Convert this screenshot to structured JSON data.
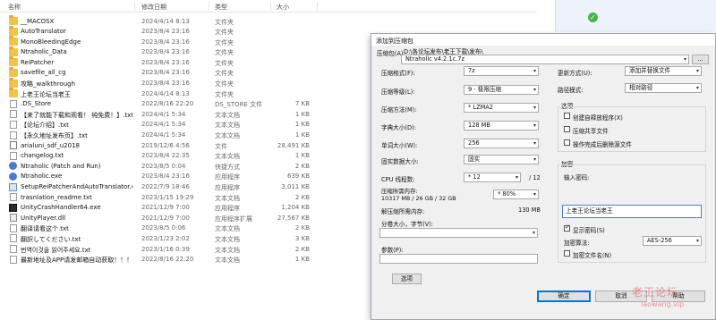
{
  "explorer": {
    "columns": {
      "name": "名称",
      "date": "修改日期",
      "type": "类型",
      "size": "大小"
    },
    "files": [
      {
        "icon": "folder-icon",
        "name": "__MACOSX",
        "date": "2024/4/14 8:13",
        "type": "文件夹",
        "size": ""
      },
      {
        "icon": "folder-icon",
        "name": "AutoTranslator",
        "date": "2023/8/4 23:16",
        "type": "文件夹",
        "size": ""
      },
      {
        "icon": "folder-icon",
        "name": "MonoBleedingEdge",
        "date": "2023/8/4 23:16",
        "type": "文件夹",
        "size": ""
      },
      {
        "icon": "folder-icon",
        "name": "Ntraholic_Data",
        "date": "2023/8/4 23:16",
        "type": "文件夹",
        "size": ""
      },
      {
        "icon": "folder-icon",
        "name": "ReiPatcher",
        "date": "2023/8/4 23:16",
        "type": "文件夹",
        "size": ""
      },
      {
        "icon": "folder-icon",
        "name": "savefile_all_cg",
        "date": "2023/8/4 23:16",
        "type": "文件夹",
        "size": ""
      },
      {
        "icon": "folder-icon",
        "name": "攻略_walkthrough",
        "date": "2023/8/4 23:16",
        "type": "文件夹",
        "size": ""
      },
      {
        "icon": "folder-icon",
        "name": "上老王论坛当老王",
        "date": "2024/4/14 8:13",
        "type": "文件夹",
        "size": ""
      },
      {
        "icon": "file-icon",
        "name": ".DS_Store",
        "date": "2022/8/16 22:20",
        "type": "DS_STORE 文件",
        "size": "7 KB"
      },
      {
        "icon": "text-file-icon",
        "name": "【来了就能下载和观看！ 纯免费！】.txt",
        "date": "2024/4/1 5:34",
        "type": "文本文档",
        "size": "1 KB"
      },
      {
        "icon": "text-file-icon",
        "name": "【论坛介绍】.txt",
        "date": "2024/4/1 5:34",
        "type": "文本文档",
        "size": "1 KB"
      },
      {
        "icon": "text-file-icon",
        "name": "【永久地址发布页】.txt",
        "date": "2024/4/1 5:34",
        "type": "文本文档",
        "size": "1 KB"
      },
      {
        "icon": "font-file-icon",
        "name": "arialuni_sdf_u2018",
        "date": "2019/12/6 4:56",
        "type": "文件",
        "size": "28,491 KB"
      },
      {
        "icon": "text-file-icon",
        "name": "changelog.txt",
        "date": "2023/8/4 22:35",
        "type": "文本文档",
        "size": "1 KB"
      },
      {
        "icon": "shortcut-icon",
        "name": "Ntraholic (Patch and Run)",
        "date": "2023/8/5 0:04",
        "type": "快捷方式",
        "size": "2 KB"
      },
      {
        "icon": "app-icon",
        "name": "Ntraholic.exe",
        "date": "2023/8/4 23:16",
        "type": "应用程序",
        "size": "639 KB"
      },
      {
        "icon": "exe-icon",
        "name": "SetupReiPatcherAndAutoTranslator.exe",
        "date": "2022/7/9 18:46",
        "type": "应用程序",
        "size": "3,011 KB"
      },
      {
        "icon": "text-file-icon",
        "name": "trasnlation_readme.txt",
        "date": "2023/1/15 19:29",
        "type": "文本文档",
        "size": "2 KB"
      },
      {
        "icon": "unity-icon",
        "name": "UnityCrashHandler64.exe",
        "date": "2021/12/9 7:00",
        "type": "应用程序",
        "size": "1,204 KB"
      },
      {
        "icon": "dll-icon",
        "name": "UnityPlayer.dll",
        "date": "2021/12/9 7:00",
        "type": "应用程序扩展",
        "size": "27,567 KB"
      },
      {
        "icon": "text-file-icon",
        "name": "翻译请看这个.txt",
        "date": "2023/8/5 0:06",
        "type": "文本文档",
        "size": "2 KB"
      },
      {
        "icon": "text-file-icon",
        "name": "翻訳してください.txt",
        "date": "2023/1/23 2:02",
        "type": "文本文档",
        "size": "3 KB"
      },
      {
        "icon": "text-file-icon",
        "name": "번역이것을 읽어주세요.txt",
        "date": "2023/1/16 0:39",
        "type": "文本文档",
        "size": "2 KB"
      },
      {
        "icon": "text-file-icon",
        "name": "最新地址及APP请发邮箱自动获取！！！...",
        "date": "2022/8/16 22:20",
        "type": "文本文档",
        "size": "1 KB"
      }
    ]
  },
  "dialog": {
    "title": "添加到压缩包",
    "archive_label": "压缩包(A):",
    "archive_path": "D:\\各论坛发布\\老王下载\\发布\\",
    "archive_name": "Ntraholic v4.2.1c.7z",
    "browse_label": "...",
    "format_label": "压缩格式(F):",
    "format_value": "7z",
    "level_label": "压缩等级(L):",
    "level_value": "9 - 极限压缩",
    "method_label": "压缩方法(M):",
    "method_value": "* LZMA2",
    "dict_label": "字典大小(D):",
    "dict_value": "128 MB",
    "word_label": "单词大小(W):",
    "word_value": "256",
    "solid_label": "固实数据大小:",
    "solid_value": "固实",
    "threads_label": "CPU 线程数:",
    "threads_value": "* 12",
    "threads_total": "/ 12",
    "mem_label": "压缩所需内存:",
    "mem_detail": "10317 MB / 26 GB / 32 GB",
    "mem_value": "* 80%",
    "decomp_mem_label": "解压缩所需内存:",
    "decomp_mem_value": "130 MB",
    "split_label": "分卷大小，字节(V):",
    "split_value": "",
    "params_label": "参数(P):",
    "params_value": "",
    "options_button": "选项",
    "update_label": "更新方式(U):",
    "update_value": "添加并替换文件",
    "path_mode_label": "路径模式:",
    "path_mode_value": "相对路径",
    "options_group": "选项",
    "opt_sfx": "创建自释放程序(X)",
    "opt_shared": "压缩共享文件",
    "opt_delete": "操作完成后删除源文件",
    "encrypt_group": "加密",
    "password_label": "输入密码:",
    "password_value": "上老王论坛当老王",
    "show_password": "显示密码(S)",
    "encrypt_method_label": "加密算法:",
    "encrypt_method_value": "AES-256",
    "encrypt_names": "加密文件名(N)",
    "ok_button": "确定",
    "cancel_button": "取消",
    "help_button": "帮助"
  },
  "watermark": {
    "main": "老王论坛",
    "sub": "laowang.vip"
  }
}
